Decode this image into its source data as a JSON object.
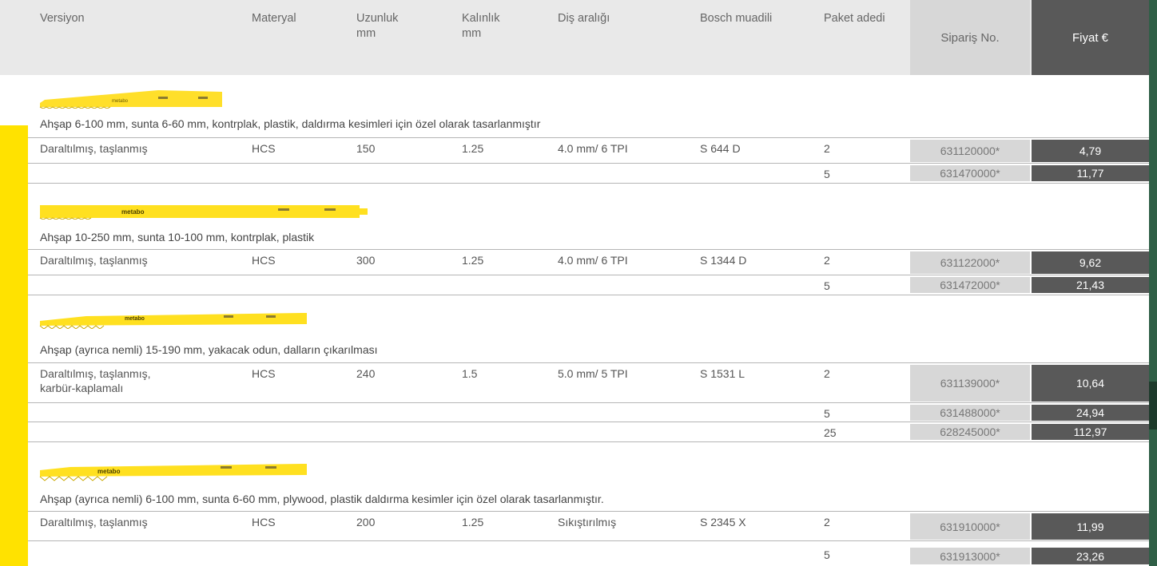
{
  "header": {
    "versiyon": "Versiyon",
    "materyal": "Materyal",
    "uzunluk_1": "Uzunluk",
    "uzunluk_2": "mm",
    "kalinlik_1": "Kalınlık",
    "kalinlik_2": "mm",
    "dis_araligi": "Diş aralığı",
    "bosch": "Bosch muadili",
    "paket": "Paket adedi",
    "siparis": "Sipariş No.",
    "fiyat": "Fiyat €"
  },
  "blade_logo_text": "metabo",
  "colors": {
    "accent_yellow": "#ffe200",
    "price_dark": "#595959",
    "order_gray": "#d7d7d7",
    "header_gray": "#e9e9e9"
  },
  "groups": [
    {
      "description": "Ahşap 6-100 mm, sunta 6-60 mm, kontrplak, plastik, daldırma kesimleri için özel olarak tasarlanmıştır",
      "rows": [
        {
          "versiyon": "Daraltılmış, taşlanmış",
          "materyal": "HCS",
          "uzunluk": "150",
          "kalinlik": "1.25",
          "dis": "4.0 mm/ 6 TPI",
          "bosch": "S 644 D",
          "paket": "2",
          "siparis": "631120000*",
          "fiyat": "4,79"
        },
        {
          "versiyon": "",
          "materyal": "",
          "uzunluk": "",
          "kalinlik": "",
          "dis": "",
          "bosch": "",
          "paket": "5",
          "siparis": "631470000*",
          "fiyat": "11,77"
        }
      ]
    },
    {
      "description": "Ahşap 10-250 mm, sunta 10-100 mm, kontrplak, plastik",
      "rows": [
        {
          "versiyon": "Daraltılmış, taşlanmış",
          "materyal": "HCS",
          "uzunluk": "300",
          "kalinlik": "1.25",
          "dis": "4.0 mm/ 6 TPI",
          "bosch": "S 1344 D",
          "paket": "2",
          "siparis": "631122000*",
          "fiyat": "9,62"
        },
        {
          "versiyon": "",
          "materyal": "",
          "uzunluk": "",
          "kalinlik": "",
          "dis": "",
          "bosch": "",
          "paket": "5",
          "siparis": "631472000*",
          "fiyat": "21,43"
        }
      ]
    },
    {
      "description": "Ahşap (ayrıca nemli) 15-190 mm, yakacak odun, dalların çıkarılması",
      "rows": [
        {
          "versiyon": "Daraltılmış, taşlanmış,",
          "versiyon2": "karbür-kaplamalı",
          "materyal": "HCS",
          "uzunluk": "240",
          "kalinlik": "1.5",
          "dis": "5.0 mm/ 5 TPI",
          "bosch": "S 1531 L",
          "paket": "2",
          "siparis": "631139000*",
          "fiyat": "10,64"
        },
        {
          "versiyon": "",
          "materyal": "",
          "uzunluk": "",
          "kalinlik": "",
          "dis": "",
          "bosch": "",
          "paket": "5",
          "siparis": "631488000*",
          "fiyat": "24,94"
        },
        {
          "versiyon": "",
          "materyal": "",
          "uzunluk": "",
          "kalinlik": "",
          "dis": "",
          "bosch": "",
          "paket": "25",
          "siparis": "628245000*",
          "fiyat": "112,97"
        }
      ]
    },
    {
      "description": "Ahşap (ayrıca nemli) 6-100 mm, sunta 6-60 mm, plywood, plastik daldırma kesimler için özel olarak tasarlanmıştır.",
      "rows": [
        {
          "versiyon": "Daraltılmış, taşlanmış",
          "materyal": "HCS",
          "uzunluk": "200",
          "kalinlik": "1.25",
          "dis": "Sıkıştırılmış",
          "bosch": "S 2345 X",
          "paket": "2",
          "siparis": "631910000*",
          "fiyat": "11,99"
        },
        {
          "versiyon": "",
          "materyal": "",
          "uzunluk": "",
          "kalinlik": "",
          "dis": "",
          "bosch": "",
          "paket": "5",
          "siparis": "631913000*",
          "fiyat": "23,26"
        }
      ]
    }
  ]
}
